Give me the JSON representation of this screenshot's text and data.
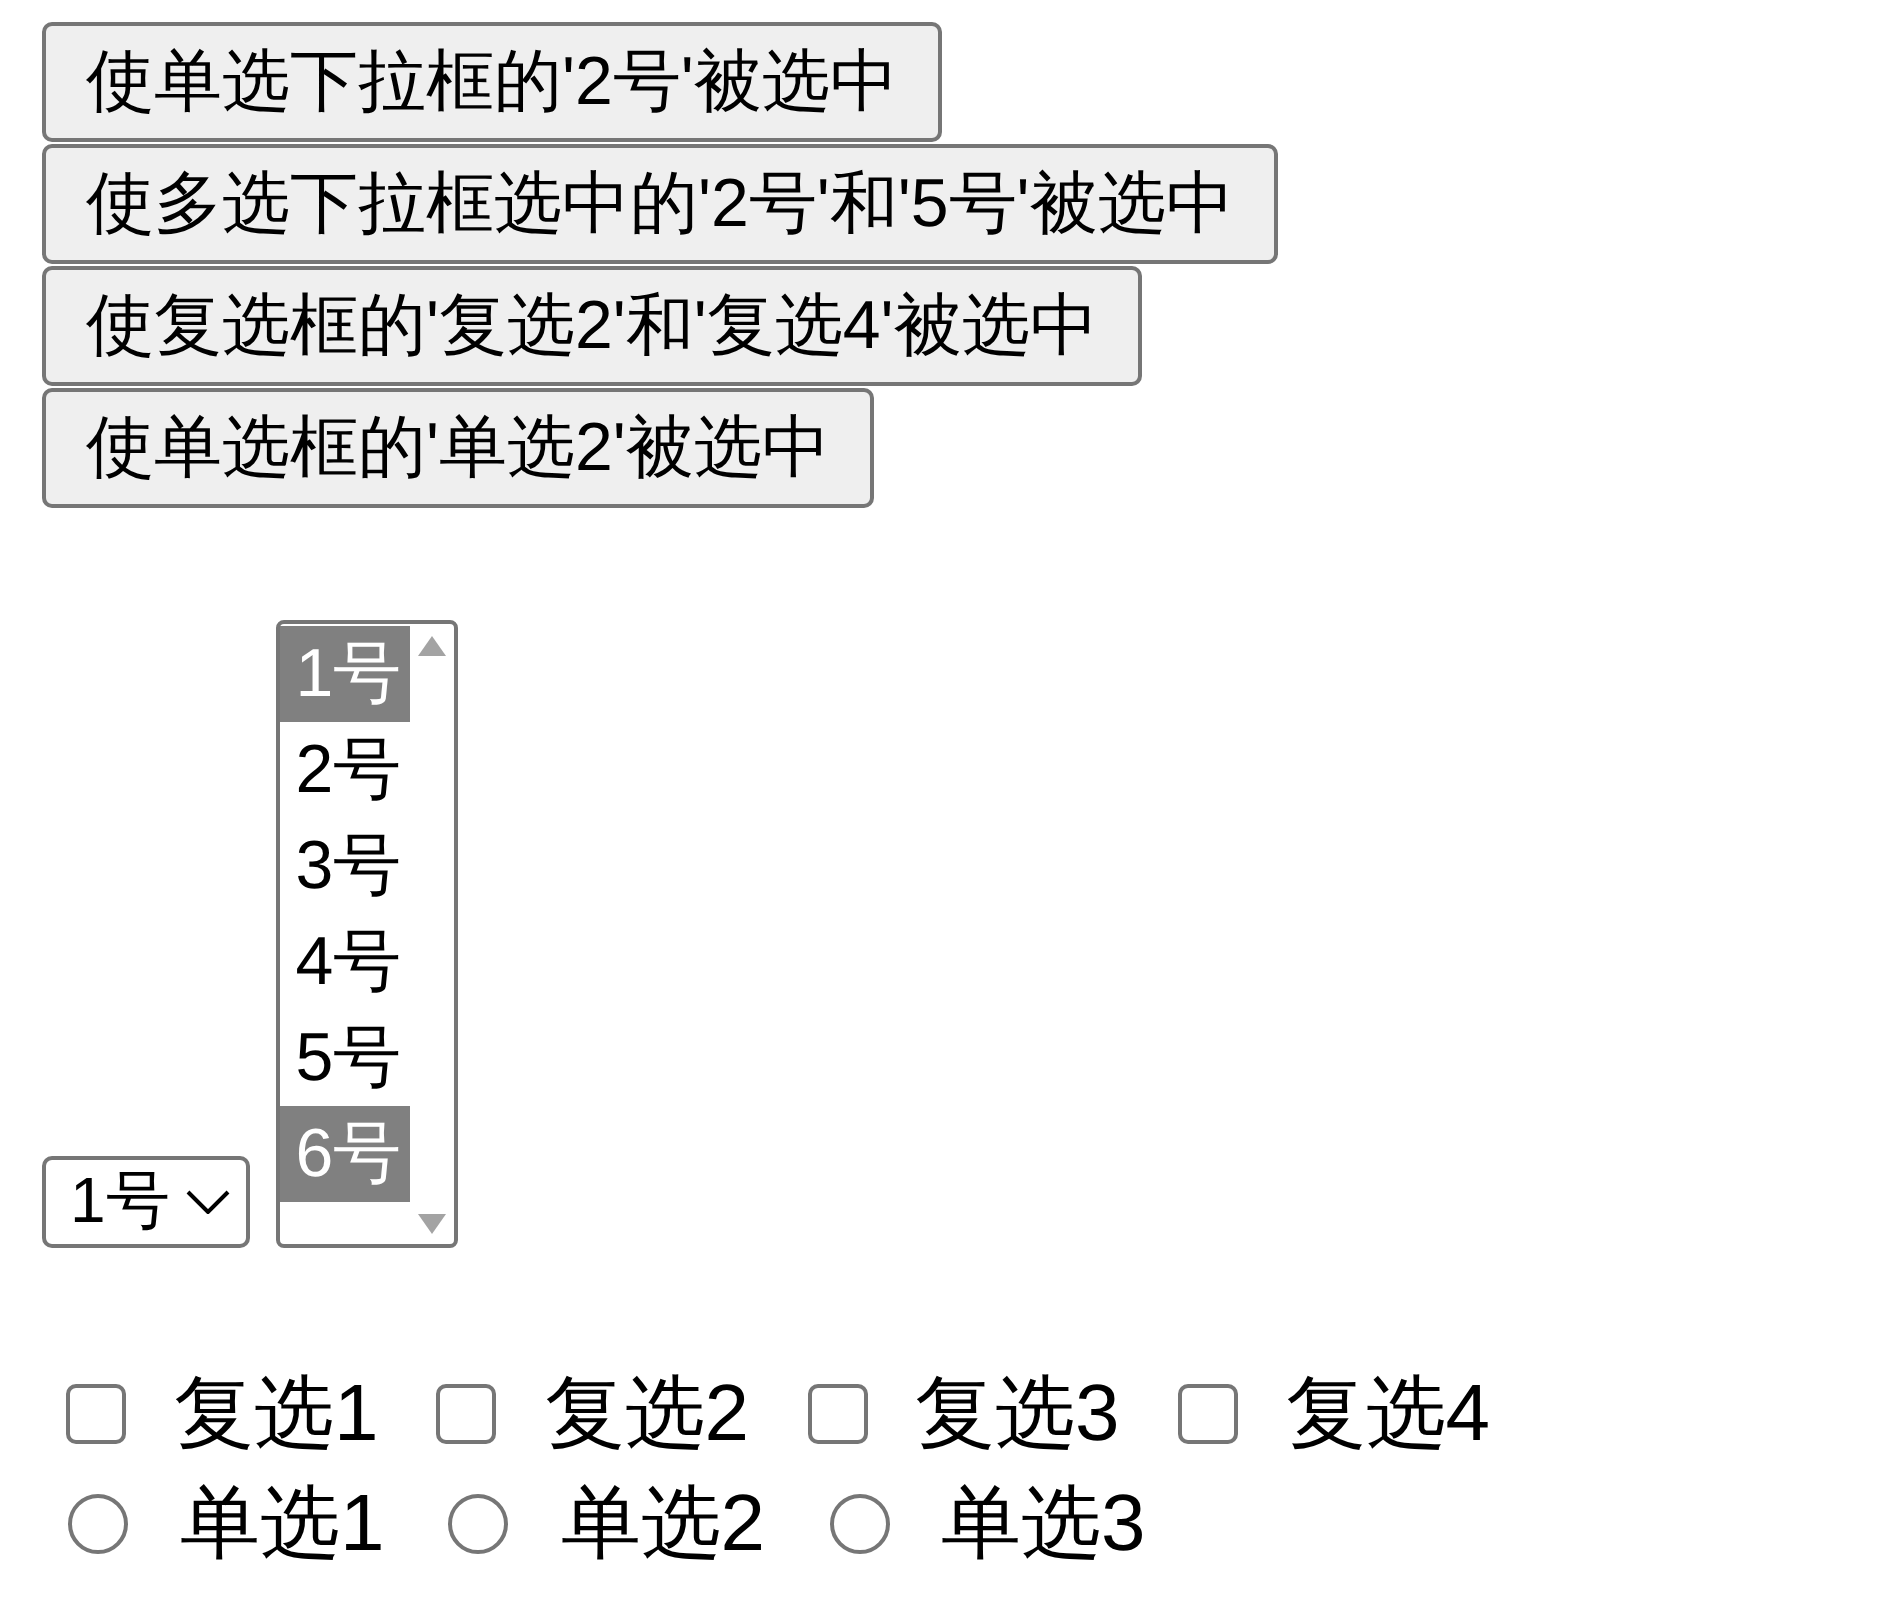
{
  "buttons": [
    {
      "label": "使单选下拉框的'2号'被选中"
    },
    {
      "label": "使多选下拉框选中的'2号'和'5号'被选中"
    },
    {
      "label": "使复选框的'复选2'和'复选4'被选中"
    },
    {
      "label": "使单选框的'单选2'被选中"
    }
  ],
  "single_select": {
    "value": "1号"
  },
  "multi_select": {
    "options": [
      {
        "label": "1号",
        "selected": true
      },
      {
        "label": "2号",
        "selected": false
      },
      {
        "label": "3号",
        "selected": false
      },
      {
        "label": "4号",
        "selected": false
      },
      {
        "label": "5号",
        "selected": false
      },
      {
        "label": "6号",
        "selected": true
      }
    ]
  },
  "checkboxes": [
    {
      "label": "复选1",
      "checked": false
    },
    {
      "label": "复选2",
      "checked": false
    },
    {
      "label": "复选3",
      "checked": false
    },
    {
      "label": "复选4",
      "checked": false
    }
  ],
  "radios": [
    {
      "label": "单选1",
      "selected": false
    },
    {
      "label": "单选2",
      "selected": false
    },
    {
      "label": "单选3",
      "selected": false
    }
  ]
}
